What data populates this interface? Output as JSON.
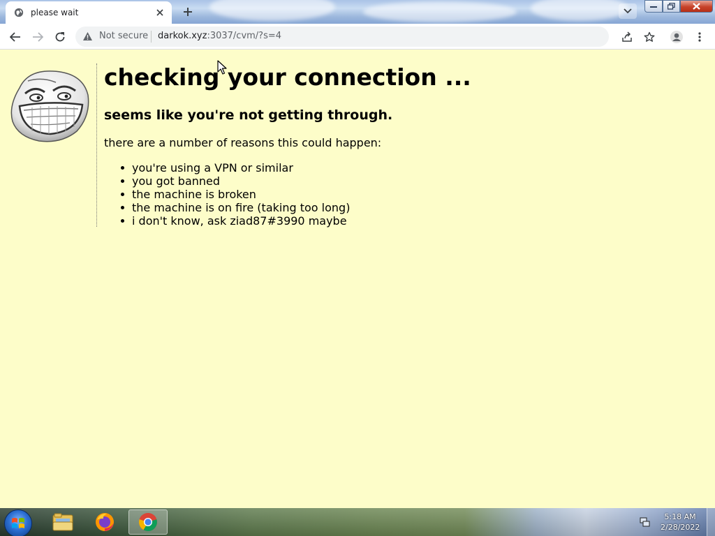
{
  "browser": {
    "tab": {
      "title": "please wait"
    },
    "omnibox": {
      "security_label": "Not secure",
      "url_host": "darkok.xyz",
      "url_rest": ":3037/cvm/?s=4"
    }
  },
  "page": {
    "heading": "checking your connection ...",
    "subheading": "seems like you're not getting through.",
    "intro": "there are a number of reasons this could happen:",
    "reasons": [
      "you're using a VPN or similar",
      "you got banned",
      "the machine is broken",
      "the machine is on fire (taking too long)",
      "i don't know, ask ziad87#3990 maybe"
    ]
  },
  "taskbar": {
    "apps": [
      "windows-explorer",
      "firefox",
      "chrome"
    ],
    "active_app": "chrome",
    "clock": {
      "time": "5:18 AM",
      "date": "2/28/2022"
    }
  },
  "colors": {
    "page_background": "#fdfdc9",
    "text": "#000000",
    "omnibox_background": "#f1f3f4"
  }
}
